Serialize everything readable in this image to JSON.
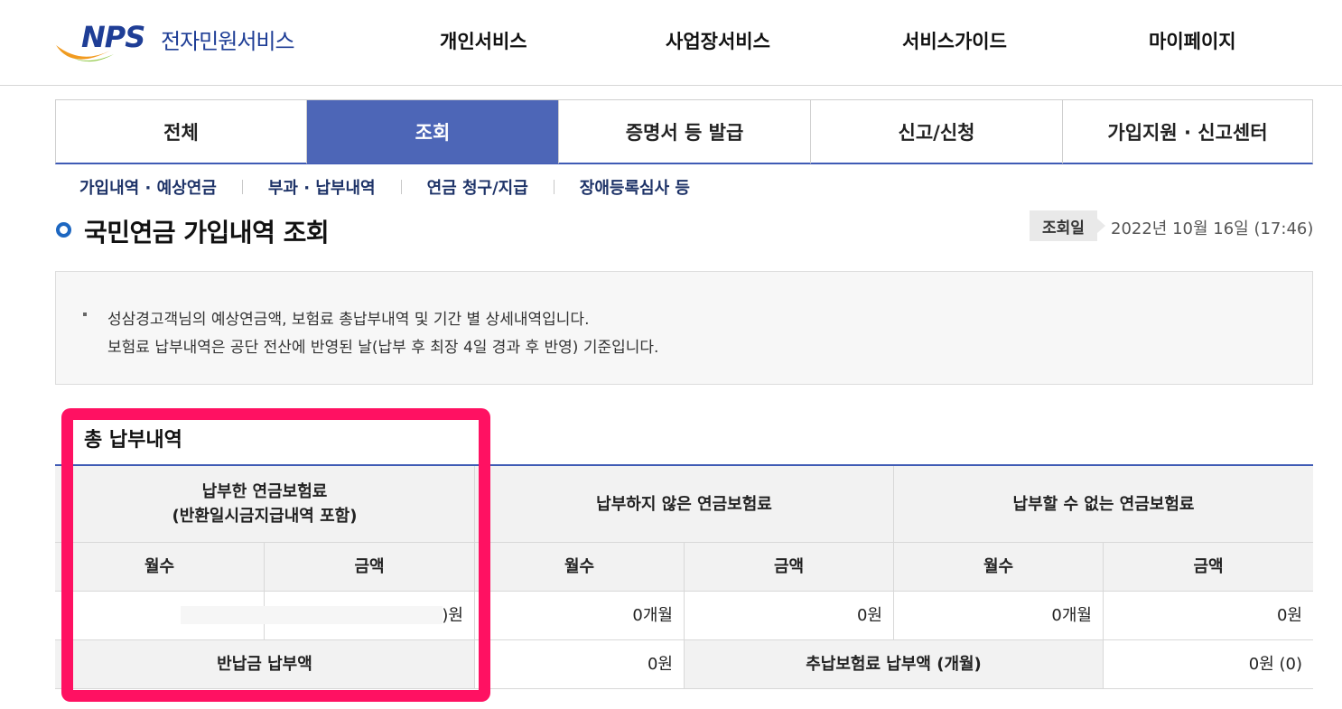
{
  "header": {
    "logo_mark": "NPS",
    "logo_text": "전자민원서비스",
    "nav": [
      "개인서비스",
      "사업장서비스",
      "서비스가이드",
      "마이페이지"
    ]
  },
  "tabs": [
    {
      "label": "전체",
      "active": false
    },
    {
      "label": "조회",
      "active": true
    },
    {
      "label": "증명서 등 발급",
      "active": false
    },
    {
      "label": "신고/신청",
      "active": false
    },
    {
      "label": "가입지원 · 신고센터",
      "active": false
    }
  ],
  "subnav": [
    "가입내역 · 예상연금",
    "부과 · 납부내역",
    "연금 청구/지급",
    "장애등록심사 등"
  ],
  "page": {
    "title": "국민연금 가입내역 조회",
    "date_label": "조회일",
    "date_value": "2022년 10월 16일 (17:46)"
  },
  "info": {
    "line1": "성삼경고객님의 예상연금액, 보험료 총납부내역 및 기간 별 상세내역입니다.",
    "line2": "보험료 납부내역은 공단 전산에 반영된 날(납부 후 최장 4일 경과 후 반영) 기준입니다."
  },
  "summary": {
    "section_title": "총 납부내역",
    "group1_header": "납부한 연금보험료\n(반환일시금지급내역 포함)",
    "group2_header": "납부하지 않은 연금보험료",
    "group3_header": "납부할 수 없는 연금보험료",
    "col_months": "월수",
    "col_amount": "금액",
    "paid_amount": ")원",
    "unpaid_months": "0개월",
    "unpaid_amount": "0원",
    "unable_months": "0개월",
    "unable_amount": "0원",
    "refund_label": "반납금 납부액",
    "refund_value": "0원",
    "late_label": "추납보험료 납부액 (개월)",
    "late_value": "0원 (0)"
  },
  "colors": {
    "brand_blue": "#1f3e96",
    "tab_active": "#4d66b7",
    "highlight": "#ff1162"
  }
}
